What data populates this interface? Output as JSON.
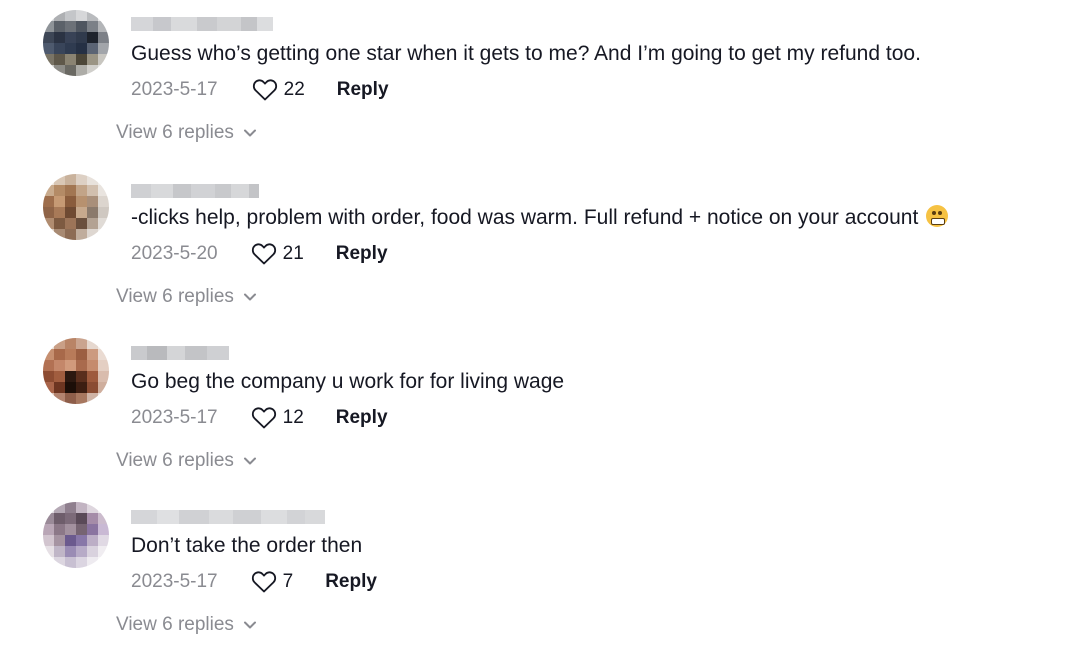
{
  "comments": [
    {
      "text": "Guess who’s getting one star when it gets to me? And I’m going to get my refund too.",
      "date": "2023-5-17",
      "likes": "22",
      "reply_label": "Reply",
      "view_replies": "View 6 replies"
    },
    {
      "text": "-clicks help, problem with order, food was warm. Full refund + notice on your account",
      "emoji": "grimacing-face-emoji",
      "date": "2023-5-20",
      "likes": "21",
      "reply_label": "Reply",
      "view_replies": "View 6 replies"
    },
    {
      "text": "Go beg the company u work for for living wage",
      "date": "2023-5-17",
      "likes": "12",
      "reply_label": "Reply",
      "view_replies": "View 6 replies"
    },
    {
      "text": "Don’t take the order then",
      "date": "2023-5-17",
      "likes": "7",
      "reply_label": "Reply",
      "view_replies": "View 6 replies"
    }
  ],
  "icons": {
    "like": "heart-outline-icon",
    "expand": "chevron-down-icon"
  },
  "colors": {
    "text": "#161823",
    "muted": "#8a8b91",
    "emoji": "#f6c243"
  }
}
